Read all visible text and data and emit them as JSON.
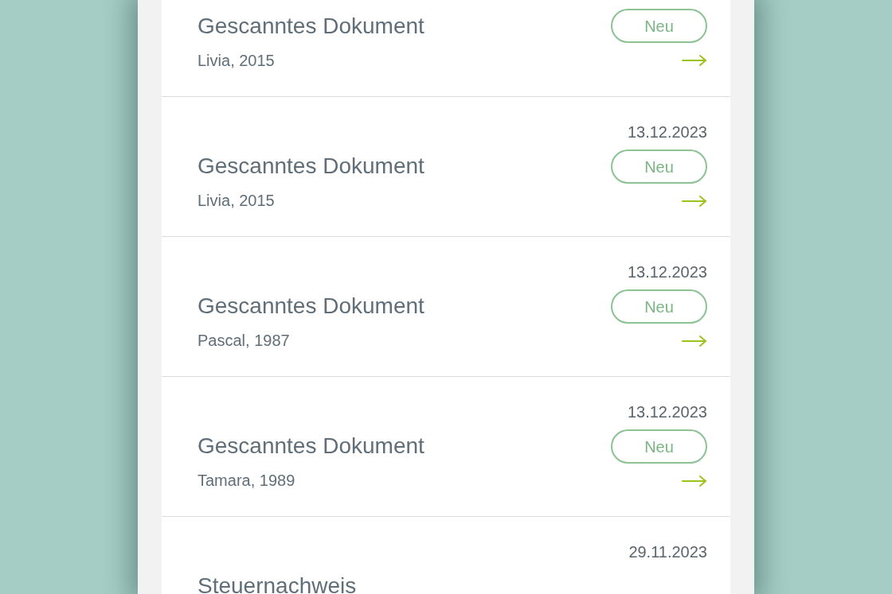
{
  "documents": [
    {
      "title": "Gescanntes Dokument",
      "subtitle": "Livia, 2015",
      "badge": "Neu"
    },
    {
      "date": "13.12.2023",
      "title": "Gescanntes Dokument",
      "subtitle": "Livia, 2015",
      "badge": "Neu"
    },
    {
      "date": "13.12.2023",
      "title": "Gescanntes Dokument",
      "subtitle": "Pascal, 1987",
      "badge": "Neu"
    },
    {
      "date": "13.12.2023",
      "title": "Gescanntes Dokument",
      "subtitle": "Tamara, 1989",
      "badge": "Neu"
    },
    {
      "date": "29.11.2023",
      "title": "Steuernachweis"
    }
  ]
}
